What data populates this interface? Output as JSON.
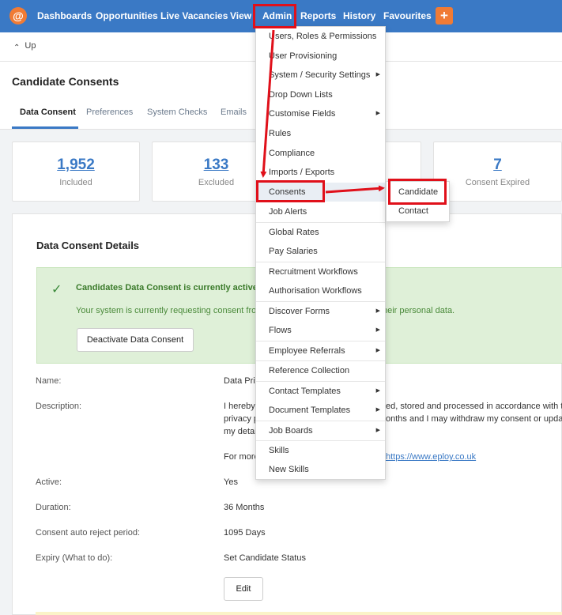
{
  "nav": {
    "items": [
      "Dashboards",
      "Opportunities",
      "Live Vacancies",
      "View",
      "Admin",
      "Reports",
      "History",
      "Favourites"
    ],
    "plus": "+",
    "logo": "@"
  },
  "upbar": {
    "label": "Up",
    "chevron": "⌃"
  },
  "page": {
    "title": "Candidate Consents",
    "tabs": [
      "Data Consent",
      "Preferences",
      "System Checks",
      "Emails"
    ]
  },
  "stats": [
    {
      "value": "1,952",
      "label": "Included"
    },
    {
      "value": "133",
      "label": "Excluded"
    },
    {
      "value": "7",
      "label": "Consent Expired"
    }
  ],
  "details": {
    "title": "Data Consent Details",
    "alert_title": "Candidates Data Consent is currently active",
    "alert_body_left": "Your system is currently requesting consent from",
    "alert_body_right": "heir personal data.",
    "deactivate_label": "Deactivate Data Consent",
    "fields": [
      {
        "label": "Name:",
        "value": "Data Priv"
      },
      {
        "label": "Description:",
        "value": "I hereby",
        "value2": "ed, stored and processed in accordance with th"
      },
      {
        "label": "",
        "value": "privacy p",
        "value2": "onths and I may withdraw my consent or update"
      },
      {
        "label": "",
        "value": "my detai"
      },
      {
        "label": "",
        "value": "For more",
        "link": "https://www.eploy.co.uk"
      },
      {
        "label": "Active:",
        "value": "Yes"
      },
      {
        "label": "Duration:",
        "value": "36 Months"
      },
      {
        "label": "Consent auto reject period:",
        "value": "1095 Days"
      },
      {
        "label": "Expiry (What to do):",
        "value": "Set Candidate Status"
      }
    ],
    "edit_label": "Edit"
  },
  "admin_menu": [
    {
      "label": "Users, Roles & Permissions",
      "sub": false
    },
    {
      "label": "User Provisioning",
      "sub": false
    },
    {
      "label": "System / Security Settings",
      "sub": true
    },
    {
      "label": "Drop Down Lists",
      "sub": false
    },
    {
      "label": "Customise Fields",
      "sub": true
    },
    {
      "label": "Rules",
      "sub": false
    },
    {
      "label": "Compliance",
      "sub": false
    },
    {
      "label": "Imports / Exports",
      "sub": false
    },
    {
      "label": "Consents",
      "sub": false
    },
    {
      "label": "Job Alerts",
      "sub": false
    },
    {
      "label": "Global Rates",
      "sub": false
    },
    {
      "label": "Pay Salaries",
      "sub": false
    },
    {
      "label": "Recruitment Workflows",
      "sub": false
    },
    {
      "label": "Authorisation Workflows",
      "sub": false
    },
    {
      "label": "Discover Forms",
      "sub": true
    },
    {
      "label": "Flows",
      "sub": true
    },
    {
      "label": "Employee Referrals",
      "sub": true
    },
    {
      "label": "Reference Collection",
      "sub": false
    },
    {
      "label": "Contact Templates",
      "sub": true
    },
    {
      "label": "Document Templates",
      "sub": true
    },
    {
      "label": "Job Boards",
      "sub": true
    },
    {
      "label": "Skills",
      "sub": false
    },
    {
      "label": "New Skills",
      "sub": false
    }
  ],
  "consents_submenu": [
    "Candidate",
    "Contact"
  ],
  "colors": {
    "nav": "#3a79c5",
    "accent": "#f07b35",
    "annotation": "#e0101a",
    "alert_bg": "#dff0d8"
  }
}
